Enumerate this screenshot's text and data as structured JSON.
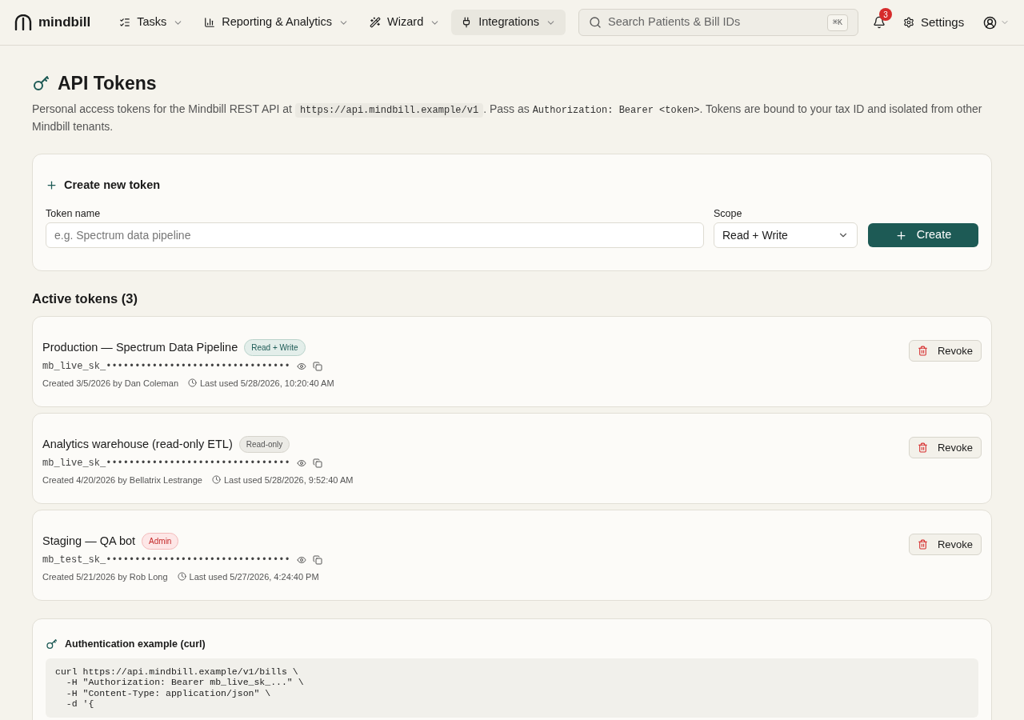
{
  "brand": "mindbill",
  "nav": [
    {
      "label": "Tasks",
      "selected": false
    },
    {
      "label": "Reporting & Analytics",
      "selected": false
    },
    {
      "label": "Wizard",
      "selected": false
    },
    {
      "label": "Integrations",
      "selected": true
    }
  ],
  "search": {
    "placeholder": "Search Patients & Bill IDs",
    "shortcut": "⌘K"
  },
  "notifications": {
    "count": "3"
  },
  "settings": "Settings",
  "page": {
    "title": "API Tokens",
    "description": [
      {
        "kind": "text",
        "text": "Personal access tokens for the Mindbill REST API at "
      },
      {
        "kind": "code",
        "text": "https://api.mindbill.example/v1"
      },
      {
        "kind": "text",
        "text": ". Pass as "
      },
      {
        "kind": "plaincode",
        "text": "Authorization: Bearer <token>"
      },
      {
        "kind": "text",
        "text": ". Tokens are bound to your tax ID and isolated from other Mindbill tenants."
      }
    ]
  },
  "create": {
    "title": "Create new token",
    "name_label": "Token name",
    "name_placeholder": "e.g. Spectrum data pipeline",
    "scope_label": "Scope",
    "scope_value": "Read + Write",
    "button": "Create"
  },
  "active_heading": "Active tokens (3)",
  "tokens": [
    {
      "name": "Production — Spectrum Data Pipeline",
      "badge": "Read + Write",
      "kind": "read_write",
      "key": "mb_live_sk_••••••••••••••••••••••••••••••••",
      "created": "Created 3/5/2026 by Dan Coleman",
      "last_used": "Last used 5/28/2026, 10:20:40 AM",
      "action": "Revoke"
    },
    {
      "name": "Analytics warehouse (read-only ETL)",
      "badge": "Read-only",
      "kind": "read_only",
      "key": "mb_live_sk_••••••••••••••••••••••••••••••••",
      "created": "Created 4/20/2026 by Bellatrix Lestrange",
      "last_used": "Last used 5/28/2026, 9:52:40 AM",
      "action": "Revoke"
    },
    {
      "name": "Staging — QA bot",
      "badge": "Admin",
      "kind": "admin",
      "key": "mb_test_sk_••••••••••••••••••••••••••••••••",
      "created": "Created 5/21/2026 by Rob Long",
      "last_used": "Last used 5/27/2026, 4:24:40 PM",
      "action": "Revoke"
    }
  ],
  "example": {
    "title": "Authentication example (curl)",
    "code": "curl https://api.mindbill.example/v1/bills \\\n  -H \"Authorization: Bearer mb_live_sk_...\" \\\n  -H \"Content-Type: application/json\" \\\n  -d '{"
  }
}
